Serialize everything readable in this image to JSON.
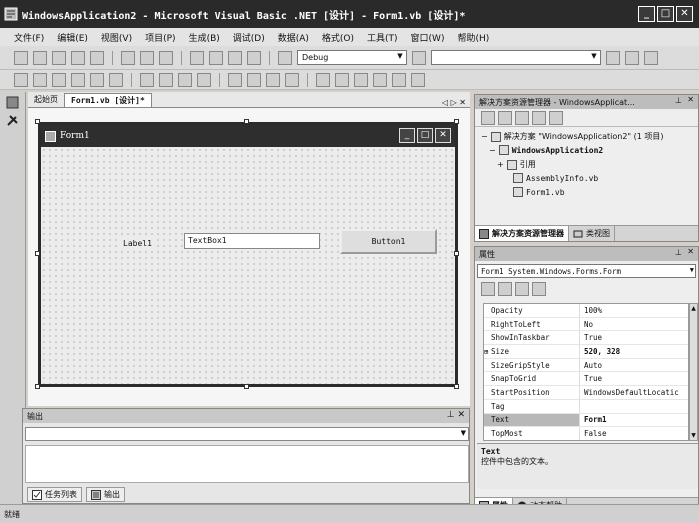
{
  "window": {
    "title": "WindowsApplication2 - Microsoft Visual Basic .NET [设计] - Form1.vb [设计]*",
    "min": "_",
    "max": "□",
    "close": "✕"
  },
  "menu": [
    "文件(F)",
    "编辑(E)",
    "视图(V)",
    "项目(P)",
    "生成(B)",
    "调试(D)",
    "数据(A)",
    "格式(O)",
    "工具(T)",
    "窗口(W)",
    "帮助(H)"
  ],
  "toolbar": {
    "config": "Debug"
  },
  "doc_tabs": {
    "start_page": "起始页",
    "form_tab": "Form1.vb [设计]*",
    "nav": "◁ ▷ ✕"
  },
  "form": {
    "title": "Form1",
    "label1": "Label1",
    "textbox1": "TextBox1",
    "button1": "Button1"
  },
  "output": {
    "title": "输出",
    "pin": "⊥ ✕",
    "tabs": [
      "任务列表",
      "输出"
    ]
  },
  "solution_explorer": {
    "title": "解决方案资源管理器 - WindowsApplicat...",
    "pin": "⊥",
    "close": "✕",
    "tree": [
      "解决方案 \"WindowsApplication2\" (1 项目)",
      "WindowsApplication2",
      "引用",
      "AssemblyInfo.vb",
      "Form1.vb"
    ],
    "tabs": [
      "解决方案资源管理器",
      "类视图"
    ]
  },
  "properties": {
    "title": "属性",
    "pin": "⊥",
    "close": "✕",
    "object": "Form1 System.Windows.Forms.Form",
    "rows": [
      {
        "name": "Opacity",
        "value": "100%"
      },
      {
        "name": "RightToLeft",
        "value": "No"
      },
      {
        "name": "ShowInTaskbar",
        "value": "True"
      },
      {
        "name": "Size",
        "value": "520, 328"
      },
      {
        "name": "SizeGripStyle",
        "value": "Auto"
      },
      {
        "name": "SnapToGrid",
        "value": "True"
      },
      {
        "name": "StartPosition",
        "value": "WindowsDefaultLocatic"
      },
      {
        "name": "Tag",
        "value": ""
      },
      {
        "name": "Text",
        "value": "Form1"
      },
      {
        "name": "TopMost",
        "value": "False"
      }
    ],
    "desc_title": "Text",
    "desc_text": "控件中包含的文本。",
    "tabs": [
      "属性",
      "动态帮助"
    ]
  },
  "status": "就绪"
}
